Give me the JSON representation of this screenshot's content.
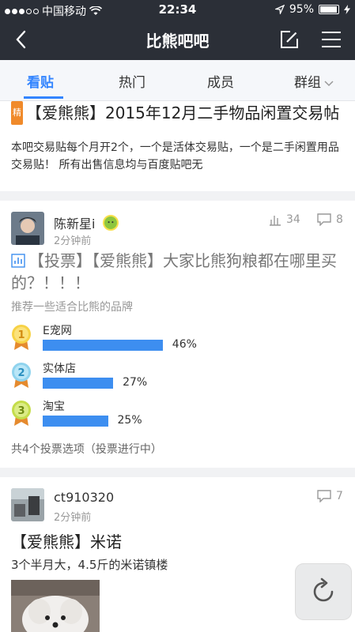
{
  "status": {
    "carrier": "中国移动",
    "time": "22:34",
    "battery": "95%",
    "battery_level": 0.95
  },
  "nav": {
    "title": "比熊吧吧"
  },
  "tabs": [
    {
      "label": "看贴"
    },
    {
      "label": "热门"
    },
    {
      "label": "成员"
    },
    {
      "label": "群组"
    }
  ],
  "posts": [
    {
      "tag": "精",
      "title": "【爱熊熊】2015年12月二手物品闲置交易帖",
      "desc": "本吧交易贴每个月开2个，一个是活体交易贴，一个是二手闲置用品交易贴！ 所有出售信息均与百度贴吧无"
    },
    {
      "user": "陈新星i",
      "time": "2分钟前",
      "views": "34",
      "comments": "8",
      "title": "【投票】【爱熊熊】大家比熊狗粮都在哪里买的？！！！",
      "sub": "推荐一些适合比熊的品牌",
      "poll": [
        {
          "rank": "1",
          "name": "E宠网",
          "pct_label": "46%",
          "pct": 46
        },
        {
          "rank": "2",
          "name": "实体店",
          "pct_label": "27%",
          "pct": 27
        },
        {
          "rank": "3",
          "name": "淘宝",
          "pct_label": "25%",
          "pct": 25
        }
      ],
      "footer": "共4个投票选项（投票进行中）"
    },
    {
      "user": "ct910320",
      "time": "2分钟前",
      "comments": "7",
      "title": "【爱熊熊】米诺",
      "desc": "3个半月大，4.5斤的米诺镇楼"
    }
  ],
  "colors": {
    "accent": "#3385ff",
    "nav_bg": "#2b2f37",
    "bar": "#3d8ef0",
    "tag": "#f08a2a"
  },
  "icons": [
    "back-icon",
    "edit-icon",
    "menu-icon",
    "signal-dots",
    "wifi-icon",
    "location-arrow-icon",
    "battery-icon",
    "chevron-down-icon",
    "chart-icon",
    "comment-icon",
    "medal-1-icon",
    "medal-2-icon",
    "medal-3-icon",
    "refresh-icon"
  ]
}
